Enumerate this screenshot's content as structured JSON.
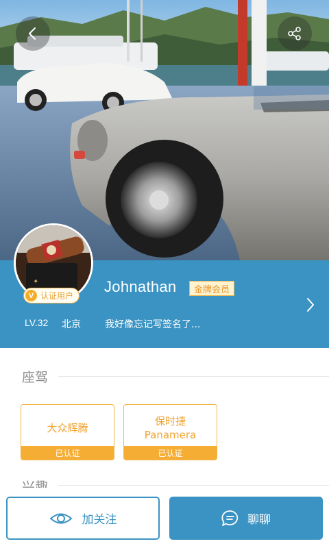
{
  "header": {
    "back_icon": "chevron-left-icon",
    "share_icon": "share-icon"
  },
  "profile": {
    "verified_label": "认证用户",
    "verified_badge": "V",
    "username": "Johnathan",
    "member_badge": "金牌会员",
    "level": "LV.32",
    "city": "北京",
    "bio": "我好像忘记写签名了...",
    "more_icon": "chevron-right-icon"
  },
  "cars_section": {
    "title": "座驾",
    "cars": [
      {
        "name_line1": "大众辉腾",
        "name_line2": "",
        "status": "已认证"
      },
      {
        "name_line1": "保时捷",
        "name_line2": "Panamera",
        "status": "已认证"
      }
    ]
  },
  "interests_section": {
    "title": "兴趣"
  },
  "actions": {
    "follow_label": "加关注",
    "follow_icon": "eye-icon",
    "chat_label": "聊聊",
    "chat_icon": "chat-bubble-icon"
  },
  "colors": {
    "primary": "#3a93c3",
    "gold": "#f0a22e",
    "gold_fill": "#f5ad34"
  }
}
